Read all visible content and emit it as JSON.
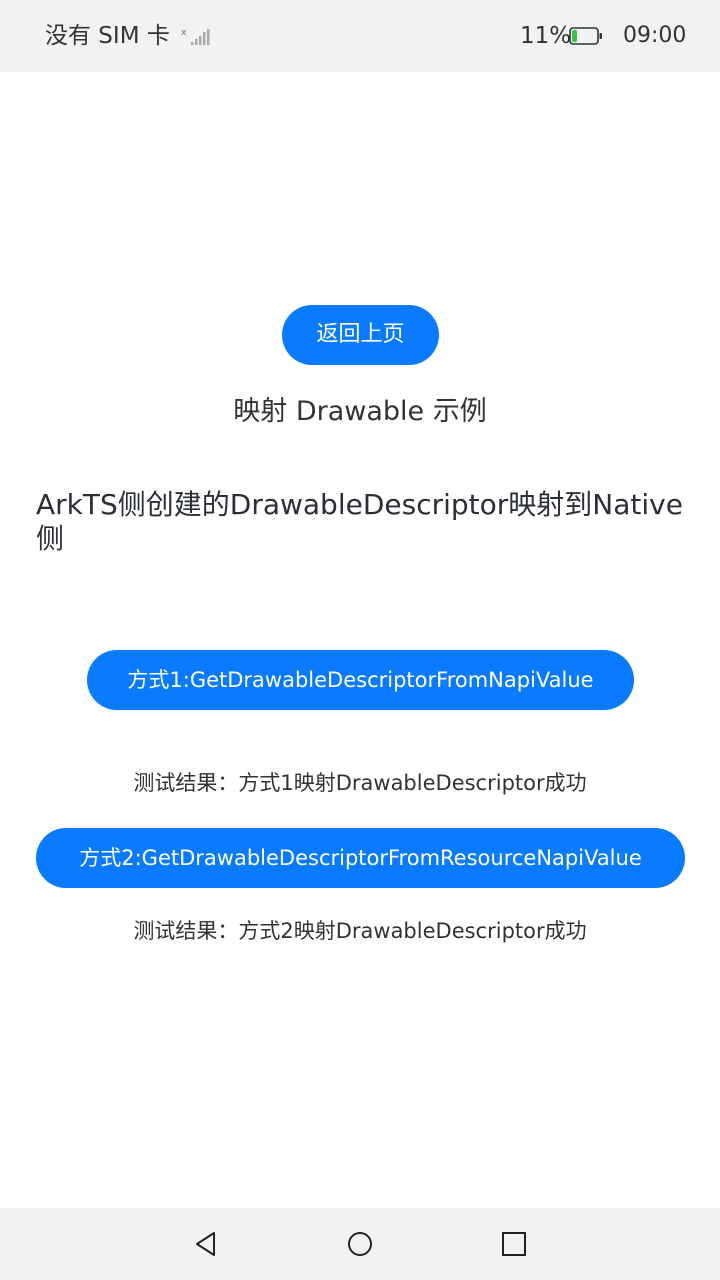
{
  "status_bar": {
    "carrier": "没有 SIM 卡",
    "battery_percent": "11%",
    "time": "09:00",
    "signal_icon": "no-signal-icon",
    "battery_icon": "battery-low-icon",
    "battery_color": "#3cc24a"
  },
  "main": {
    "back_button_label": "返回上页",
    "page_title": "映射 Drawable 示例",
    "section_heading": "ArkTS侧创建的DrawableDescriptor映射到Native侧",
    "method1_button_label": "方式1:GetDrawableDescriptorFromNapiValue",
    "method1_result": "测试结果：方式1映射DrawableDescriptor成功",
    "method2_button_label": "方式2:GetDrawableDescriptorFromResourceNapiValue",
    "method2_result": "测试结果：方式2映射DrawableDescriptor成功",
    "accent_color": "#0a7aff"
  },
  "nav_bar": {
    "back_icon": "triangle-back-icon",
    "home_icon": "circle-home-icon",
    "recent_icon": "square-recent-icon"
  }
}
